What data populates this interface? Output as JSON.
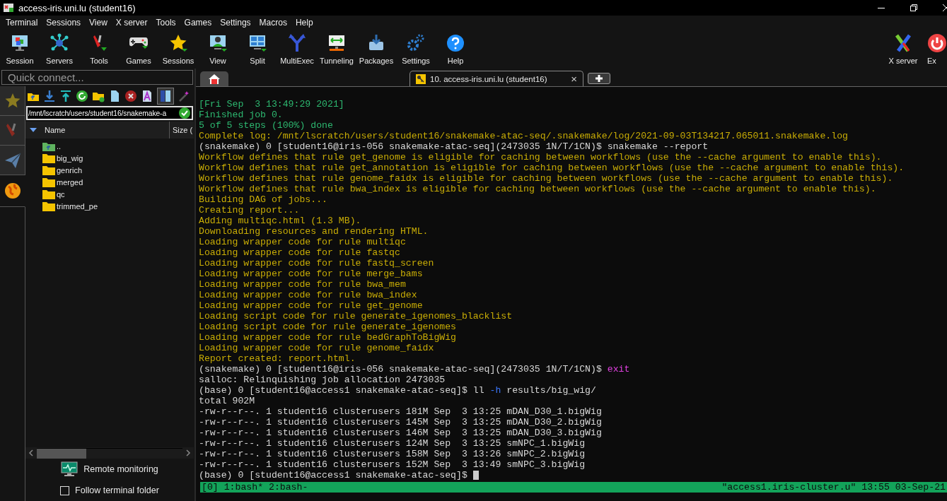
{
  "window": {
    "title": "access-iris.uni.lu (student16)"
  },
  "menu": [
    "Terminal",
    "Sessions",
    "View",
    "X server",
    "Tools",
    "Games",
    "Settings",
    "Macros",
    "Help"
  ],
  "toolbar": [
    "Session",
    "Servers",
    "Tools",
    "Games",
    "Sessions",
    "View",
    "Split",
    "MultiExec",
    "Tunneling",
    "Packages",
    "Settings",
    "Help"
  ],
  "toolbar_right": [
    "X server",
    "Ex"
  ],
  "quick_connect": {
    "placeholder": "Quick connect..."
  },
  "side_tabs": [
    {
      "selected": false
    },
    {
      "selected": false
    },
    {
      "selected": false
    },
    {
      "selected": true
    }
  ],
  "file_browser": {
    "split_toggle_pressed": true,
    "path": "/mnt/lscratch/users/student16/snakemake-a",
    "columns": [
      "Name",
      "Size ("
    ],
    "items": [
      {
        "kind": "parent",
        "name": ".."
      },
      {
        "kind": "folder",
        "name": "big_wig"
      },
      {
        "kind": "folder",
        "name": "genrich"
      },
      {
        "kind": "folder",
        "name": "merged"
      },
      {
        "kind": "folder",
        "name": "qc"
      },
      {
        "kind": "folder",
        "name": "trimmed_pe"
      }
    ],
    "remote_monitoring": "Remote monitoring",
    "follow_terminal_folder": {
      "label": "Follow terminal folder",
      "checked": false
    }
  },
  "tabs": [
    {
      "kind": "home",
      "selected": false
    },
    {
      "kind": "session",
      "label": "10. access-iris.uni.lu (student16)",
      "close": "×",
      "selected": true
    },
    {
      "kind": "new"
    }
  ],
  "terminal": {
    "lines": [
      [
        {
          "kind": "status",
          "text": "[Fri Sep  3 13:49:29 2021]"
        }
      ],
      [
        {
          "kind": "status",
          "text": "Finished job 0."
        }
      ],
      [
        {
          "kind": "status",
          "text": "5 of 5 steps (100%) done"
        }
      ],
      [
        {
          "kind": "output",
          "text": "Complete log: /mnt/lscratch/users/student16/snakemake-atac-seq/.snakemake/log/2021-09-03T134217.065011.snakemake.log"
        }
      ],
      [
        {
          "kind": "plain",
          "text": "(snakemake) 0 [student16@iris-056 snakemake-atac-seq](2473035 1N/T/1CN)$ snakemake --report"
        }
      ],
      [
        {
          "kind": "output",
          "text": "Workflow defines that rule get_genome is eligible for caching between workflows (use the --cache argument to enable this)."
        }
      ],
      [
        {
          "kind": "output",
          "text": "Workflow defines that rule get_annotation is eligible for caching between workflows (use the --cache argument to enable this)."
        }
      ],
      [
        {
          "kind": "output",
          "text": "Workflow defines that rule genome_faidx is eligible for caching between workflows (use the --cache argument to enable this)."
        }
      ],
      [
        {
          "kind": "output",
          "text": "Workflow defines that rule bwa_index is eligible for caching between workflows (use the --cache argument to enable this)."
        }
      ],
      [
        {
          "kind": "output",
          "text": "Building DAG of jobs..."
        }
      ],
      [
        {
          "kind": "output",
          "text": "Creating report..."
        }
      ],
      [
        {
          "kind": "output",
          "text": "Adding multiqc.html (1.3 MB)."
        }
      ],
      [
        {
          "kind": "output",
          "text": "Downloading resources and rendering HTML."
        }
      ],
      [
        {
          "kind": "output",
          "text": "Loading wrapper code for rule multiqc"
        }
      ],
      [
        {
          "kind": "output",
          "text": "Loading wrapper code for rule fastqc"
        }
      ],
      [
        {
          "kind": "output",
          "text": "Loading wrapper code for rule fastq_screen"
        }
      ],
      [
        {
          "kind": "output",
          "text": "Loading wrapper code for rule merge_bams"
        }
      ],
      [
        {
          "kind": "output",
          "text": "Loading wrapper code for rule bwa_mem"
        }
      ],
      [
        {
          "kind": "output",
          "text": "Loading wrapper code for rule bwa_index"
        }
      ],
      [
        {
          "kind": "output",
          "text": "Loading wrapper code for rule get_genome"
        }
      ],
      [
        {
          "kind": "output",
          "text": "Loading script code for rule generate_igenomes_blacklist"
        }
      ],
      [
        {
          "kind": "output",
          "text": "Loading script code for rule generate_igenomes"
        }
      ],
      [
        {
          "kind": "output",
          "text": "Loading wrapper code for rule bedGraphToBigWig"
        }
      ],
      [
        {
          "kind": "output",
          "text": "Loading wrapper code for rule genome_faidx"
        }
      ],
      [
        {
          "kind": "output",
          "text": "Report created: report.html."
        }
      ],
      [
        {
          "kind": "plain",
          "text": "(snakemake) 0 [student16@iris-056 snakemake-atac-seq](2473035 1N/T/1CN)$ "
        },
        {
          "kind": "command",
          "text": "exit"
        }
      ],
      [
        {
          "kind": "plain",
          "text": "salloc: Relinquishing job allocation 2473035"
        }
      ],
      [
        {
          "kind": "plain",
          "text": "(base) 0 [student16@access1 snakemake-atac-seq]$ ll "
        },
        {
          "kind": "option",
          "text": "-h"
        },
        {
          "kind": "plain",
          "text": " results/big_wig/"
        }
      ],
      [
        {
          "kind": "plain",
          "text": "total 902M"
        }
      ],
      [
        {
          "kind": "plain",
          "text": "-rw-r--r--. 1 student16 clusterusers 181M Sep  3 13:25 mDAN_D30_1.bigWig"
        }
      ],
      [
        {
          "kind": "plain",
          "text": "-rw-r--r--. 1 student16 clusterusers 145M Sep  3 13:25 mDAN_D30_2.bigWig"
        }
      ],
      [
        {
          "kind": "plain",
          "text": "-rw-r--r--. 1 student16 clusterusers 146M Sep  3 13:25 mDAN_D30_3.bigWig"
        }
      ],
      [
        {
          "kind": "plain",
          "text": "-rw-r--r--. 1 student16 clusterusers 124M Sep  3 13:25 smNPC_1.bigWig"
        }
      ],
      [
        {
          "kind": "plain",
          "text": "-rw-r--r--. 1 student16 clusterusers 158M Sep  3 13:26 smNPC_2.bigWig"
        }
      ],
      [
        {
          "kind": "plain",
          "text": "-rw-r--r--. 1 student16 clusterusers 152M Sep  3 13:49 smNPC_3.bigWig"
        }
      ],
      [
        {
          "kind": "plain",
          "text": "(base) 0 [student16@access1 snakemake-atac-seq]$ "
        },
        {
          "kind": "cursor"
        }
      ]
    ],
    "status_left": "[0] 1:bash* 2:bash-",
    "status_right": "\"access1.iris-cluster.u\" 13:55 03-Sep-21"
  }
}
